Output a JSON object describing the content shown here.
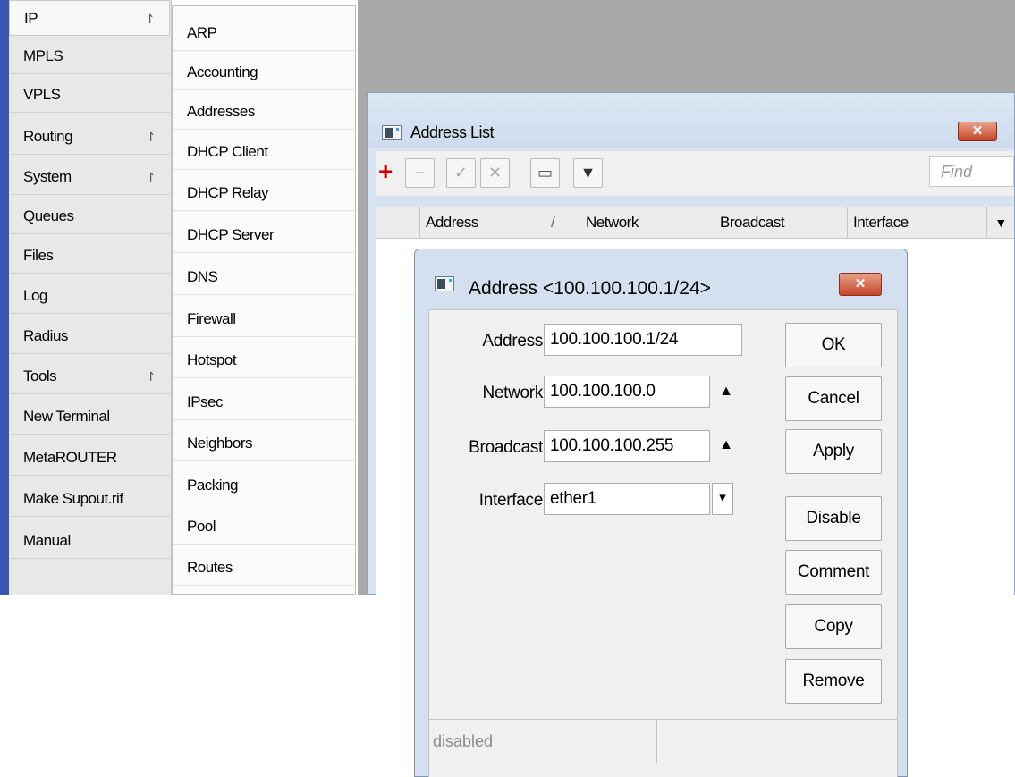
{
  "left_menu": {
    "items": [
      {
        "label": "IP",
        "submenu": true,
        "icon": "submenu-arrow-icon"
      },
      {
        "label": "MPLS"
      },
      {
        "label": "VPLS"
      },
      {
        "label": "Routing",
        "submenu": true,
        "icon": "submenu-arrow-icon"
      },
      {
        "label": "System",
        "submenu": true,
        "icon": "submenu-arrow-icon"
      },
      {
        "label": "Queues"
      },
      {
        "label": "Files"
      },
      {
        "label": "Log"
      },
      {
        "label": "Radius"
      },
      {
        "label": "Tools",
        "submenu": true,
        "icon": "submenu-arrow-icon"
      },
      {
        "label": "New Terminal"
      },
      {
        "label": "MetaROUTER"
      },
      {
        "label": "Make Supout.rif"
      },
      {
        "label": "Manual"
      }
    ],
    "arrow_glyph": "↾"
  },
  "sub_menu": {
    "items": [
      "ARP",
      "Accounting",
      "Addresses",
      "DHCP Client",
      "DHCP Relay",
      "DHCP Server",
      "DNS",
      "Firewall",
      "Hotspot",
      "IPsec",
      "Neighbors",
      "Packing",
      "Pool",
      "Routes"
    ]
  },
  "address_list": {
    "title": "Address List",
    "close_label": "✕",
    "toolbar": {
      "add": "+",
      "remove": "−",
      "enable": "✓",
      "disable": "✕",
      "comment": "▭",
      "filter": "▼",
      "find_placeholder": "Find"
    },
    "columns": [
      "Address",
      "Network",
      "Broadcast",
      "Interface"
    ],
    "sort_glyph": "/",
    "column_menu_glyph": "▼"
  },
  "address_dialog": {
    "title": "Address <100.100.100.1/24>",
    "close_label": "✕",
    "fields": {
      "address_label": "Address:",
      "address_value": "100.100.100.1/24",
      "network_label": "Network:",
      "network_value": "100.100.100.0",
      "broadcast_label": "Broadcast:",
      "broadcast_value": "100.100.100.255",
      "interface_label": "Interface:",
      "interface_value": "ether1"
    },
    "up_glyph": "▲",
    "dropdown_glyph": "▾",
    "buttons": {
      "ok": "OK",
      "cancel": "Cancel",
      "apply": "Apply",
      "disable": "Disable",
      "comment": "Comment",
      "copy": "Copy",
      "remove": "Remove"
    },
    "status": {
      "state": "disabled",
      "extra": ""
    }
  },
  "colors": {
    "accent_strip": "#3a57b5",
    "close_button": "#c4462b",
    "add_icon": "#cc0000"
  }
}
